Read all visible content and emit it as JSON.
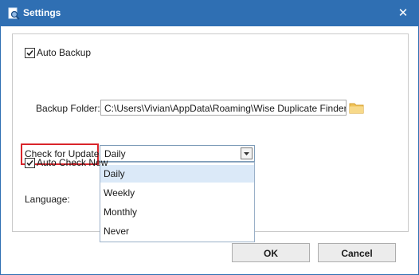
{
  "window": {
    "title": "Settings",
    "app_icon": "magnifier-document-icon",
    "close_icon": "close-icon",
    "close_glyph": "✕"
  },
  "auto_backup": {
    "label": "Auto Backup",
    "checked": true,
    "folder_label": "Backup Folder:",
    "folder_value": "C:\\Users\\Vivian\\AppData\\Roaming\\Wise Duplicate Finder\\",
    "folder_icon": "folder-icon"
  },
  "updates": {
    "label": "Check for Updates:",
    "selected": "Daily",
    "options": [
      "Daily",
      "Weekly",
      "Monthly",
      "Never"
    ],
    "arrow_icon": "chevron-down-icon"
  },
  "auto_check": {
    "label": "Auto Check New",
    "checked": true
  },
  "language": {
    "label": "Language:"
  },
  "footer": {
    "ok_label": "OK",
    "cancel_label": "Cancel"
  },
  "colors": {
    "titlebar": "#2f6fb3",
    "highlight_border": "#d9252b",
    "selected_option": "#dbe9f8"
  }
}
